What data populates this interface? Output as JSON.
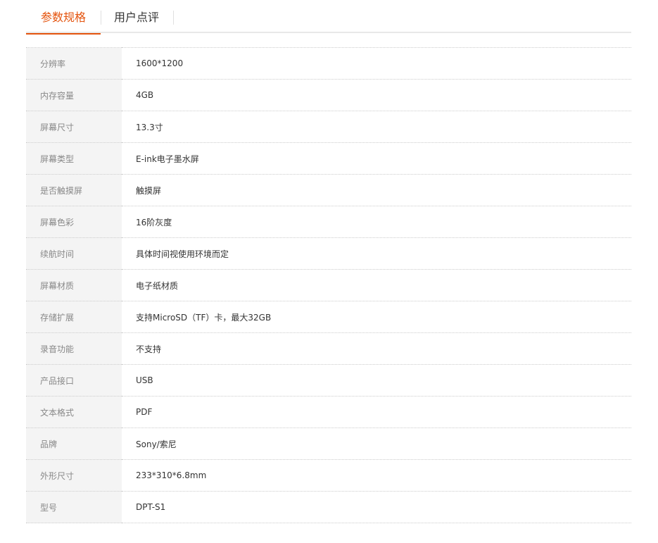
{
  "tabs": [
    {
      "label": "参数规格",
      "active": true
    },
    {
      "label": "用户点评",
      "active": false
    }
  ],
  "accent_color": "#e4530d",
  "specs": [
    {
      "label": "分辨率",
      "value": "1600*1200"
    },
    {
      "label": "内存容量",
      "value": "4GB"
    },
    {
      "label": "屏幕尺寸",
      "value": "13.3寸"
    },
    {
      "label": "屏幕类型",
      "value": "E-ink电子墨水屏"
    },
    {
      "label": "是否触摸屏",
      "value": "触摸屏"
    },
    {
      "label": "屏幕色彩",
      "value": "16阶灰度"
    },
    {
      "label": "续航时间",
      "value": "具体时间视使用环境而定"
    },
    {
      "label": "屏幕材质",
      "value": "电子纸材质"
    },
    {
      "label": "存储扩展",
      "value": "支持MicroSD（TF）卡，最大32GB"
    },
    {
      "label": "录音功能",
      "value": "不支持"
    },
    {
      "label": "产品接口",
      "value": "USB"
    },
    {
      "label": "文本格式",
      "value": "PDF"
    },
    {
      "label": "品牌",
      "value": "Sony/索尼"
    },
    {
      "label": "外形尺寸",
      "value": "233*310*6.8mm"
    },
    {
      "label": "型号",
      "value": "DPT-S1"
    }
  ]
}
